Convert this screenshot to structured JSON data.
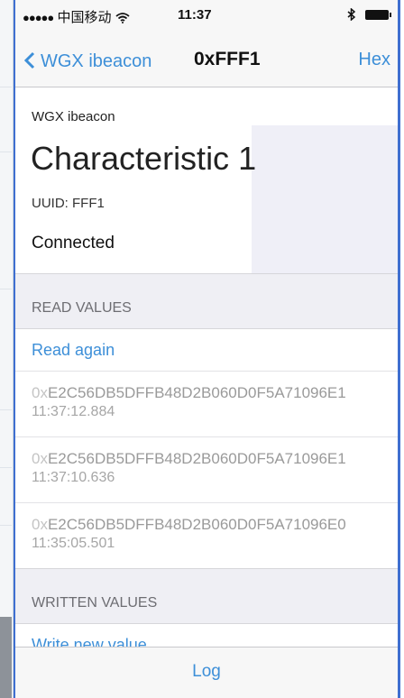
{
  "status_bar": {
    "carrier": "中国移动",
    "time": "11:37"
  },
  "nav": {
    "back_label": "WGX ibeacon",
    "title": "0xFFF1",
    "right_button": "Hex"
  },
  "header": {
    "device_name": "WGX ibeacon",
    "characteristic_title": "Characteristic 1",
    "uuid": "UUID: FFF1",
    "connection_status": "Connected"
  },
  "read_section": {
    "heading": "READ VALUES",
    "action": "Read again",
    "values": [
      {
        "prefix": "0x",
        "hex": "E2C56DB5DFFB48D2B060D0F5A71096E1",
        "time": "11:37:12.884"
      },
      {
        "prefix": "0x",
        "hex": "E2C56DB5DFFB48D2B060D0F5A71096E1",
        "time": "11:37:10.636"
      },
      {
        "prefix": "0x",
        "hex": "E2C56DB5DFFB48D2B060D0F5A71096E0",
        "time": "11:35:05.501"
      }
    ]
  },
  "written_section": {
    "heading": "WRITTEN VALUES",
    "action": "Write new value"
  },
  "toolbar": {
    "log_label": "Log"
  },
  "colors": {
    "accent": "#3d8fd8",
    "frame": "#3f6fd0"
  }
}
